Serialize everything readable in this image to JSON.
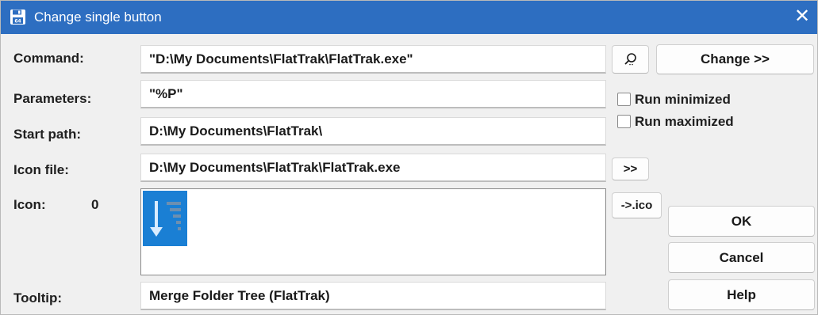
{
  "window": {
    "title": "Change single button",
    "close_glyph": "✕"
  },
  "labels": {
    "command": "Command:",
    "parameters": "Parameters:",
    "start_path": "Start path:",
    "icon_file": "Icon file:",
    "icon": "Icon:",
    "icon_index": "0",
    "tooltip": "Tooltip:"
  },
  "fields": {
    "command": "\"D:\\My Documents\\FlatTrak\\FlatTrak.exe\"",
    "parameters": "\"%P\"",
    "start_path": "D:\\My Documents\\FlatTrak\\",
    "icon_file": "D:\\My Documents\\FlatTrak\\FlatTrak.exe",
    "tooltip": "Merge Folder Tree (FlatTrak)"
  },
  "buttons": {
    "change": "Change >>",
    "browse_icon": ">>",
    "to_ico": "->.ico",
    "ok": "OK",
    "cancel": "Cancel",
    "help": "Help"
  },
  "checkboxes": {
    "run_minimized": {
      "label": "Run minimized",
      "checked": false
    },
    "run_maximized": {
      "label": "Run maximized",
      "checked": false
    }
  },
  "icons": {
    "app": "floppy-disk-icon",
    "find": "magnifier-icon",
    "preview": "flattrak-app-icon"
  },
  "colors": {
    "titlebar": "#2d6ec1",
    "preview_bg": "#1a7fd4"
  }
}
